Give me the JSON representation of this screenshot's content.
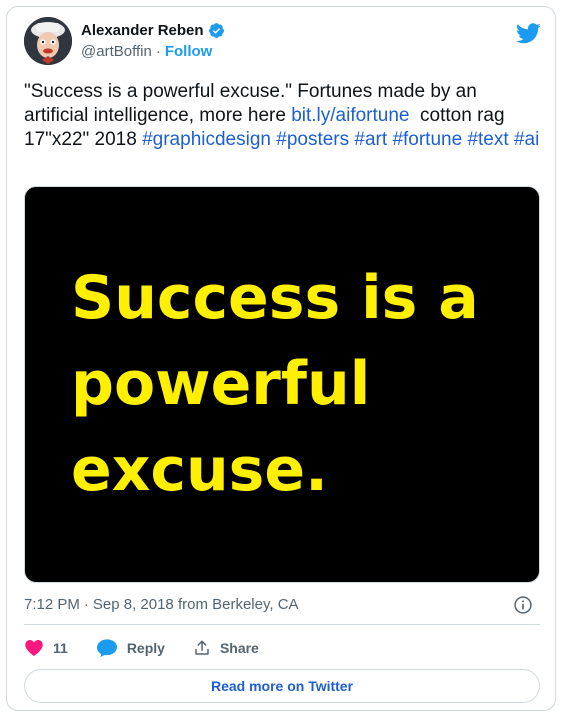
{
  "author": {
    "display_name": "Alexander Reben",
    "handle": "@artBoffin",
    "separator": "·",
    "follow_label": "Follow",
    "verified_icon": "verified-badge-icon"
  },
  "tweet": {
    "text_before_link": "\"Success is a powerful excuse.\" Fortunes made by an artificial intelligence, more here ",
    "link": "bit.ly/aifortune",
    "text_after_link": "  cotton rag 17\"x22\" 2018 ",
    "hashtags": [
      "#graphicdesign",
      "#posters",
      "#art",
      "#fortune",
      "#text",
      "#ai"
    ]
  },
  "media": {
    "line1": "Success is a",
    "line2": "powerful",
    "line3": "excuse."
  },
  "meta": {
    "time": "7:12 PM",
    "separator": "·",
    "date": "Sep 8, 2018 from Berkeley, CA"
  },
  "actions": {
    "like_count": "11",
    "reply_label": "Reply",
    "share_label": "Share"
  },
  "read_more_label": "Read more on Twitter",
  "colors": {
    "accent": "#1d9bf0",
    "link": "#1d5fd0",
    "like": "#f91880",
    "poster_text": "#ffef00",
    "poster_bg": "#000000"
  }
}
